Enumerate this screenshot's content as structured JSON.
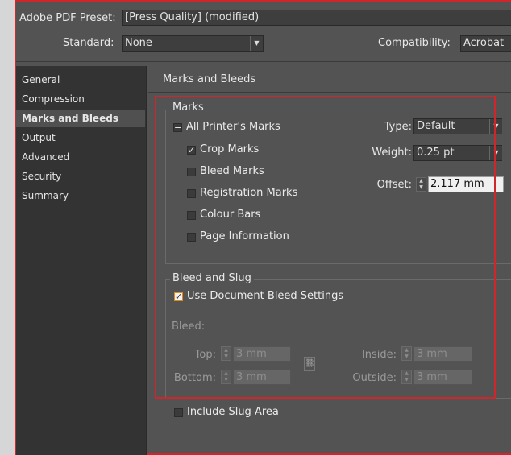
{
  "header": {
    "preset_label": "Adobe PDF Preset:",
    "preset_value": "[Press Quality] (modified)",
    "standard_label": "Standard:",
    "standard_value": "None",
    "compat_label": "Compatibility:",
    "compat_value": "Acrobat"
  },
  "sidebar": {
    "items": [
      {
        "label": "General"
      },
      {
        "label": "Compression"
      },
      {
        "label": "Marks and Bleeds"
      },
      {
        "label": "Output"
      },
      {
        "label": "Advanced"
      },
      {
        "label": "Security"
      },
      {
        "label": "Summary"
      }
    ],
    "selected": "Marks and Bleeds"
  },
  "panel": {
    "title": "Marks and Bleeds",
    "marks": {
      "group_label": "Marks",
      "all_printers_marks": "All Printer's Marks",
      "all_state": "−",
      "crop_marks": "Crop Marks",
      "crop_state": "✓",
      "bleed_marks": "Bleed Marks",
      "registration_marks": "Registration Marks",
      "colour_bars": "Colour Bars",
      "page_information": "Page Information",
      "type_label": "Type:",
      "type_value": "Default",
      "weight_label": "Weight:",
      "weight_value": "0.25 pt",
      "offset_label": "Offset:",
      "offset_value": "2.117 mm"
    },
    "bleed": {
      "group_label": "Bleed and Slug",
      "use_doc": "Use Document Bleed Settings",
      "use_doc_state": "✓",
      "bleed_label": "Bleed:",
      "top_label": "Top:",
      "top_value": "3 mm",
      "bottom_label": "Bottom:",
      "bottom_value": "3 mm",
      "inside_label": "Inside:",
      "inside_value": "3 mm",
      "outside_label": "Outside:",
      "outside_value": "3 mm"
    },
    "slug": {
      "include_slug": "Include Slug Area"
    }
  },
  "colors": {
    "highlight": "#d0252b",
    "dialog_bg": "#535353",
    "sidebar_bg": "#333333",
    "checkbox_accent": "#e08a1e"
  }
}
